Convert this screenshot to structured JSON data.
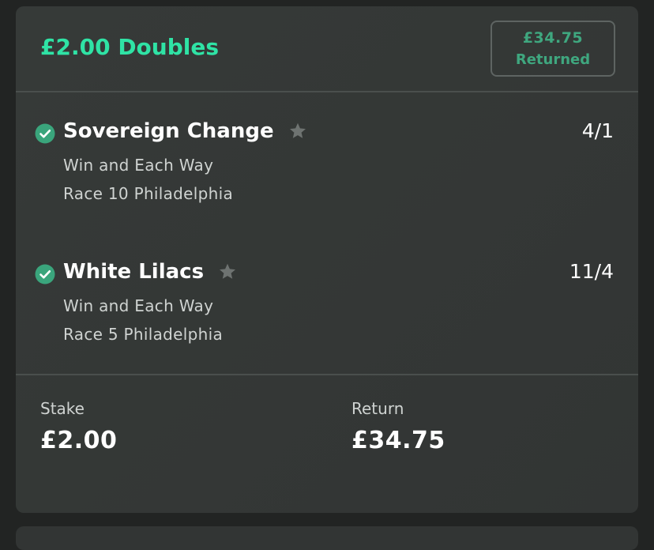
{
  "bet": {
    "title": "£2.00 Doubles",
    "returned_amount": "£34.75",
    "returned_label": "Returned"
  },
  "selections": [
    {
      "runner": "Sovereign Change",
      "odds": "4/1",
      "market": "Win and Each Way",
      "race": "Race 10 Philadelphia",
      "status": "won"
    },
    {
      "runner": "White Lilacs",
      "odds": "11/4",
      "market": "Win and Each Way",
      "race": "Race 5 Philadelphia",
      "status": "won"
    }
  ],
  "summary": {
    "stake_label": "Stake",
    "stake_value": "£2.00",
    "return_label": "Return",
    "return_value": "£34.75"
  },
  "colors": {
    "accent": "#2fe3a5",
    "returned_text": "#3fa77f",
    "check": "#3aa57c",
    "card_bg": "#353937",
    "page_bg": "#222423"
  },
  "icons": {
    "status": "check-circle-icon",
    "favourite": "star-icon"
  }
}
